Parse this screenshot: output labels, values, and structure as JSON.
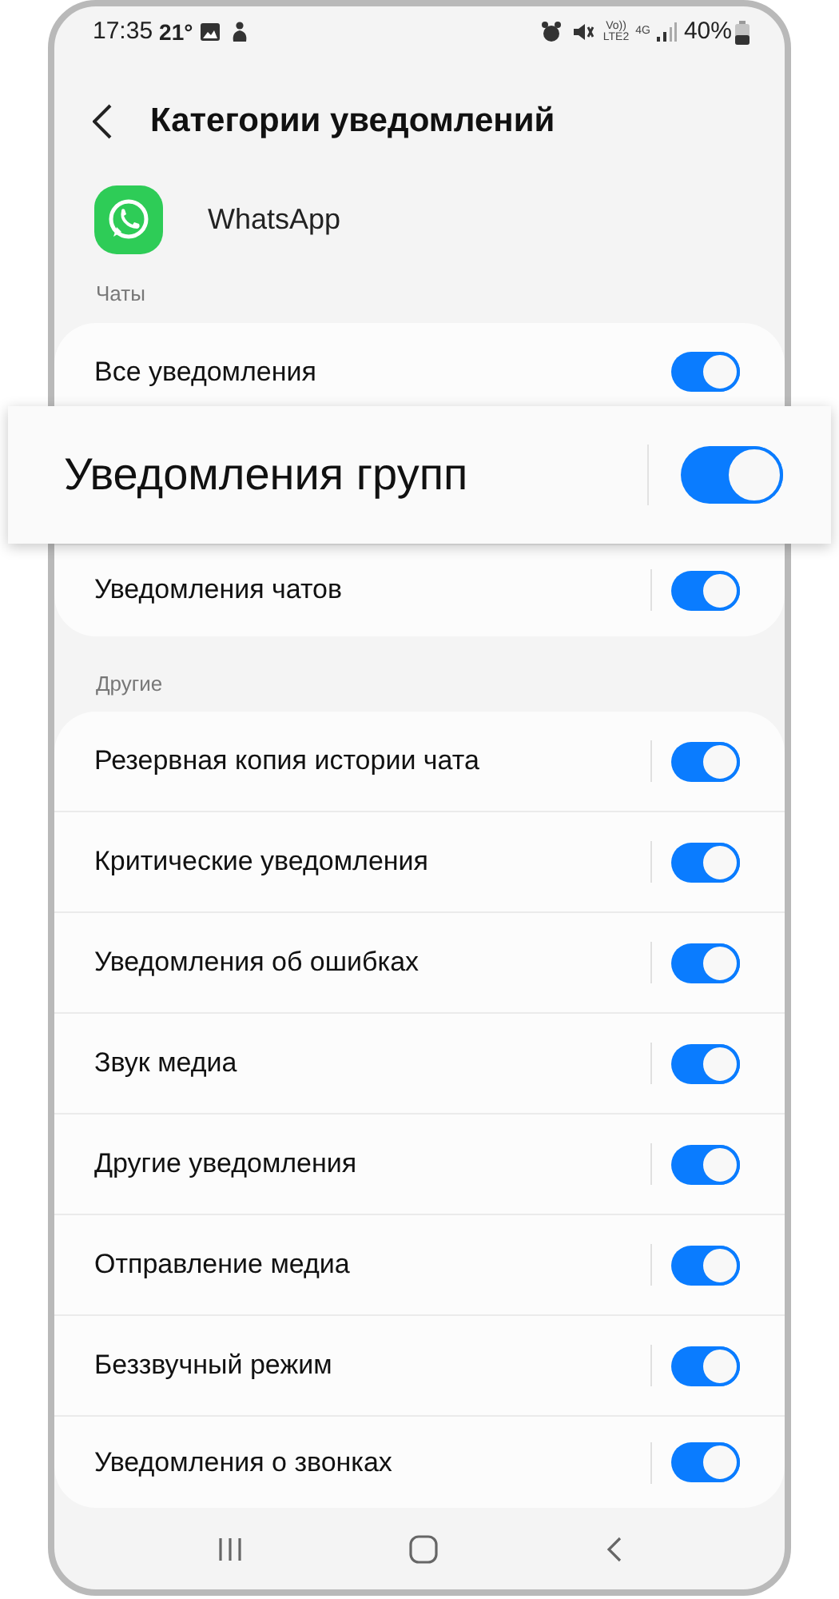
{
  "status_bar": {
    "time": "17:35",
    "temperature": "21°",
    "volte": "Vo))",
    "lte": "LTE2",
    "network": "4G",
    "battery": "40%"
  },
  "header": {
    "title": "Категории уведомлений"
  },
  "app": {
    "name": "WhatsApp"
  },
  "sections": [
    {
      "title": "Чаты",
      "items": [
        {
          "label": "Все уведомления",
          "on": true,
          "divider": false,
          "kind": "row"
        },
        {
          "label": "Уведомления групп",
          "on": true,
          "divider": true,
          "kind": "magnified"
        },
        {
          "label": "Уведомления чатов",
          "on": true,
          "divider": true,
          "kind": "row"
        }
      ]
    },
    {
      "title": "Другие",
      "items": [
        {
          "label": "Резервная копия истории чата",
          "on": true,
          "divider": true,
          "kind": "row"
        },
        {
          "label": "Критические уведомления",
          "on": true,
          "divider": true,
          "kind": "row"
        },
        {
          "label": "Уведомления об ошибках",
          "on": true,
          "divider": true,
          "kind": "row"
        },
        {
          "label": "Звук медиа",
          "on": true,
          "divider": true,
          "kind": "row"
        },
        {
          "label": "Другие уведомления",
          "on": true,
          "divider": true,
          "kind": "row"
        },
        {
          "label": "Отправление медиа",
          "on": true,
          "divider": true,
          "kind": "row"
        },
        {
          "label": "Беззвучный режим",
          "on": true,
          "divider": true,
          "kind": "row"
        },
        {
          "label": "Уведомления о звонках",
          "on": true,
          "divider": true,
          "kind": "row"
        }
      ]
    }
  ]
}
